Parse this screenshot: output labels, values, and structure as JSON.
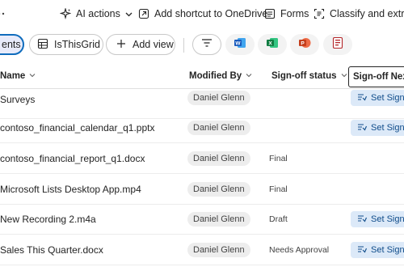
{
  "command_bar": {
    "ai_actions": "AI actions",
    "add_shortcut": "Add shortcut to OneDrive",
    "forms": "Forms",
    "classify": "Classify and extract"
  },
  "view_bar": {
    "selected_view": "ents",
    "grid_view": "IsThisGrid",
    "add_view": "Add view"
  },
  "columns": {
    "name": "Name",
    "modified_by": "Modified By",
    "signoff_status": "Sign-off status",
    "signoff_next": "Sign-off Next S"
  },
  "rows": [
    {
      "name": "Surveys",
      "modified_by": "Daniel Glenn",
      "status": "",
      "action": "Set Sign-o"
    },
    {
      "name": "contoso_financial_calendar_q1.pptx",
      "modified_by": "Daniel Glenn",
      "status": "",
      "action": "Set Sign-o"
    },
    {
      "name": "contoso_financial_report_q1.docx",
      "modified_by": "Daniel Glenn",
      "status": "Final",
      "action": ""
    },
    {
      "name": "Microsoft Lists Desktop App.mp4",
      "modified_by": "Daniel Glenn",
      "status": "Final",
      "action": ""
    },
    {
      "name": "New Recording 2.m4a",
      "modified_by": "Daniel Glenn",
      "status": "Draft",
      "action": "Set Sign-o"
    },
    {
      "name": "Sales This Quarter.docx",
      "modified_by": "Daniel Glenn",
      "status": "Needs Approval",
      "action": "Set Sign-o"
    }
  ],
  "icons": {
    "ai": "sparkle-icon",
    "shortcut": "add-shortcut-icon",
    "forms": "forms-icon",
    "classify": "classify-icon",
    "grid": "grid-view-icon",
    "add_view": "plus-icon",
    "filter": "filter-icon",
    "word": "word-icon",
    "excel": "excel-icon",
    "ppt": "powerpoint-icon",
    "forms_file": "forms-file-icon",
    "flow": "flow-icon"
  },
  "colors": {
    "accent": "#0f6cbd",
    "word": "#185abd",
    "excel": "#107c41",
    "powerpoint": "#c43e1c",
    "forms": "#b4262a",
    "flow_button_bg": "#dce9f8"
  }
}
